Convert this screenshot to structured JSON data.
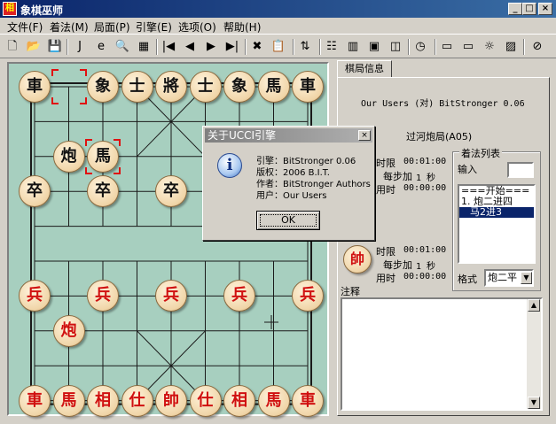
{
  "window": {
    "title": "象棋巫师",
    "app_icon_char": "相",
    "min": "_",
    "max": "□",
    "close": "×"
  },
  "menu": [
    "文件(F)",
    "着法(M)",
    "局面(P)",
    "引擎(E)",
    "选项(O)",
    "帮助(H)"
  ],
  "toolbar": [
    {
      "name": "new-icon",
      "glyph": "🗋"
    },
    {
      "name": "open-icon",
      "glyph": "📂"
    },
    {
      "name": "save-icon",
      "glyph": "💾"
    },
    {
      "name": "java-icon",
      "glyph": "J"
    },
    {
      "name": "ie-icon",
      "glyph": "e"
    },
    {
      "name": "preview-icon",
      "glyph": "🔍"
    },
    {
      "name": "copy-board-icon",
      "glyph": "▦"
    },
    {
      "name": "first-move-icon",
      "glyph": "|◀"
    },
    {
      "name": "prev-move-icon",
      "glyph": "◀"
    },
    {
      "name": "next-move-icon",
      "glyph": "▶"
    },
    {
      "name": "last-move-icon",
      "glyph": "▶|"
    },
    {
      "name": "delete-icon",
      "glyph": "✖"
    },
    {
      "name": "paste-icon",
      "glyph": "📋"
    },
    {
      "name": "flip-icon",
      "glyph": "⇅"
    },
    {
      "name": "tree-icon",
      "glyph": "☷"
    },
    {
      "name": "book-icon",
      "glyph": "▥"
    },
    {
      "name": "engine-icon",
      "glyph": "▣"
    },
    {
      "name": "analyze-icon",
      "glyph": "◫"
    },
    {
      "name": "clock-icon",
      "glyph": "◷"
    },
    {
      "name": "computer-icon",
      "glyph": "▭"
    },
    {
      "name": "computer2-icon",
      "glyph": "▭"
    },
    {
      "name": "bulb-icon",
      "glyph": "☼"
    },
    {
      "name": "chart-icon",
      "glyph": "▨"
    },
    {
      "name": "stop-icon",
      "glyph": "⊘"
    }
  ],
  "board": {
    "black_pieces": [
      {
        "c": "車",
        "f": 0,
        "r": 0
      },
      {
        "c": "象",
        "f": 2,
        "r": 0
      },
      {
        "c": "士",
        "f": 3,
        "r": 0
      },
      {
        "c": "將",
        "f": 4,
        "r": 0
      },
      {
        "c": "士",
        "f": 5,
        "r": 0
      },
      {
        "c": "象",
        "f": 6,
        "r": 0
      },
      {
        "c": "馬",
        "f": 7,
        "r": 0
      },
      {
        "c": "車",
        "f": 8,
        "r": 0
      },
      {
        "c": "炮",
        "f": 1,
        "r": 2
      },
      {
        "c": "馬",
        "f": 2,
        "r": 2
      },
      {
        "c": "卒",
        "f": 0,
        "r": 3
      },
      {
        "c": "卒",
        "f": 2,
        "r": 3
      },
      {
        "c": "卒",
        "f": 4,
        "r": 3
      }
    ],
    "red_pieces": [
      {
        "c": "兵",
        "f": 0,
        "r": 6
      },
      {
        "c": "兵",
        "f": 2,
        "r": 6
      },
      {
        "c": "兵",
        "f": 4,
        "r": 6
      },
      {
        "c": "兵",
        "f": 6,
        "r": 6
      },
      {
        "c": "兵",
        "f": 8,
        "r": 6
      },
      {
        "c": "炮",
        "f": 1,
        "r": 7
      },
      {
        "c": "車",
        "f": 0,
        "r": 9
      },
      {
        "c": "馬",
        "f": 1,
        "r": 9
      },
      {
        "c": "相",
        "f": 2,
        "r": 9
      },
      {
        "c": "仕",
        "f": 3,
        "r": 9
      },
      {
        "c": "帥",
        "f": 4,
        "r": 9
      },
      {
        "c": "仕",
        "f": 5,
        "r": 9
      },
      {
        "c": "相",
        "f": 6,
        "r": 9
      },
      {
        "c": "馬",
        "f": 7,
        "r": 9
      },
      {
        "c": "車",
        "f": 8,
        "r": 9
      }
    ],
    "highlights": [
      {
        "f": 1,
        "r": 0
      },
      {
        "f": 2,
        "r": 2
      }
    ]
  },
  "panel": {
    "tab": "棋局信息",
    "players": "Our Users (对) BitStronger 0.06",
    "opening": "过河炮局(A05)",
    "black_clock": {
      "time_label": "时限",
      "time": "00:01:00",
      "inc_label": "每步加",
      "inc": "1 秒",
      "used_label": "用时",
      "used": "00:00:00"
    },
    "red_clock": {
      "time_label": "时限",
      "time": "00:01:00",
      "inc_label": "每步加",
      "inc": "1 秒",
      "used_label": "用时",
      "used": "00:00:00"
    },
    "red_badge": "帥",
    "moves": {
      "legend": "着法列表",
      "input_label": "输入",
      "items": [
        "===开始===",
        "1. 炮二进四",
        "马2进3"
      ],
      "selected": 2,
      "format_label": "格式",
      "format_value": "炮二平"
    },
    "comment_label": "注释"
  },
  "dialog": {
    "title": "关于UCCI引擎",
    "lines": [
      "引擎：BitStronger 0.06",
      "版权：2006 B.I.T.",
      "作者：BitStronger Authors",
      "用户：Our Users"
    ],
    "ok": "OK"
  }
}
